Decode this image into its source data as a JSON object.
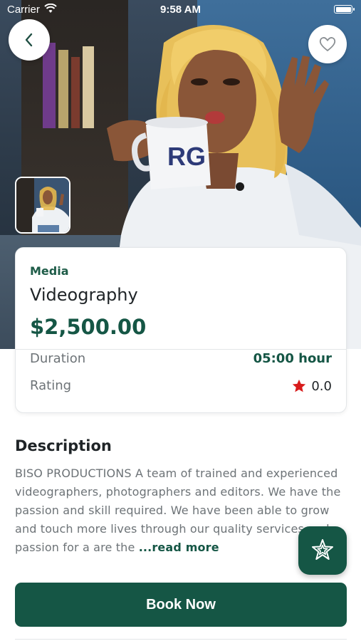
{
  "status_bar": {
    "carrier": "Carrier",
    "time": "9:58 AM"
  },
  "hero": {
    "back_icon": "chevron-left-icon",
    "favorite_icon": "heart-outline-icon",
    "thumbnail_count": 1
  },
  "service": {
    "category": "Media",
    "title": "Videography",
    "price": "$2,500.00",
    "duration_label": "Duration",
    "duration_value": "05:00 hour",
    "rating_label": "Rating",
    "rating_value": "0.0",
    "rating_icon": "star-icon"
  },
  "description": {
    "heading": "Description",
    "text": "BISO PRODUCTIONS A team of trained and experienced videographers, photographers and editors. We have the passion and skill required. We have been able to grow and touch more lives through our quality services and passion for a are the",
    "read_more": "...read more"
  },
  "fab": {
    "icon": "star-badge-icon"
  },
  "actions": {
    "book_label": "Book Now"
  },
  "colors": {
    "primary": "#155645",
    "rating_star": "#d81b1b",
    "text_muted": "#6d7377"
  }
}
